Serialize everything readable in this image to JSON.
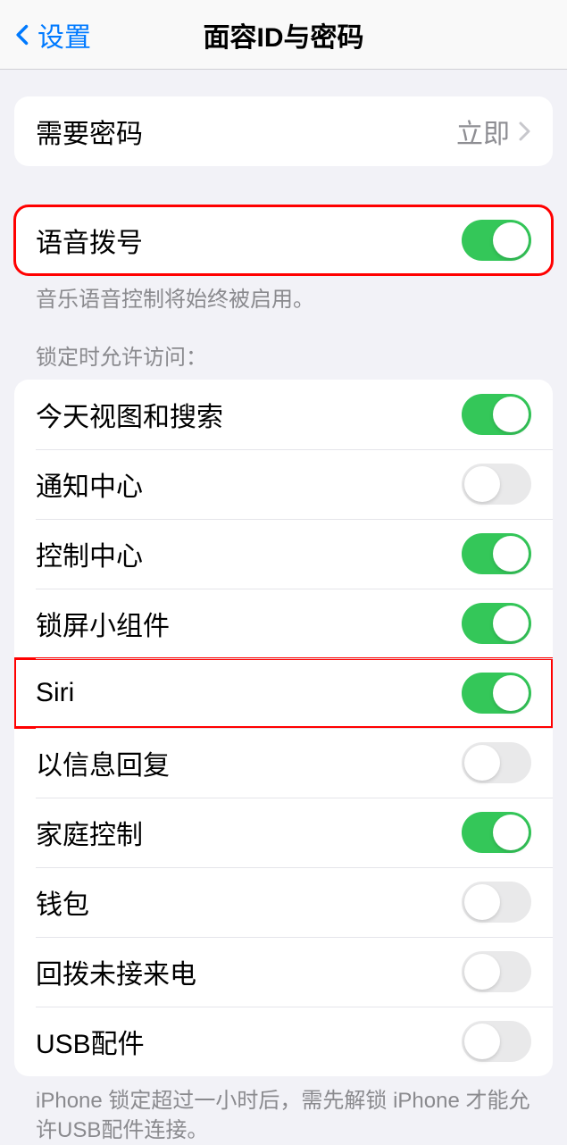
{
  "header": {
    "back_label": "设置",
    "title": "面容ID与密码"
  },
  "passcode": {
    "label": "需要密码",
    "value": "立即"
  },
  "voice_dial": {
    "label": "语音拨号",
    "footer": "音乐语音控制将始终被启用。"
  },
  "access": {
    "header": "锁定时允许访问：",
    "items": [
      {
        "label": "今天视图和搜索",
        "on": true
      },
      {
        "label": "通知中心",
        "on": false
      },
      {
        "label": "控制中心",
        "on": true
      },
      {
        "label": "锁屏小组件",
        "on": true
      },
      {
        "label": "Siri",
        "on": true
      },
      {
        "label": "以信息回复",
        "on": false
      },
      {
        "label": "家庭控制",
        "on": true
      },
      {
        "label": "钱包",
        "on": false
      },
      {
        "label": "回拨未接来电",
        "on": false
      },
      {
        "label": "USB配件",
        "on": false
      }
    ],
    "footer": "iPhone 锁定超过一小时后，需先解锁 iPhone 才能允许USB配件连接。"
  }
}
